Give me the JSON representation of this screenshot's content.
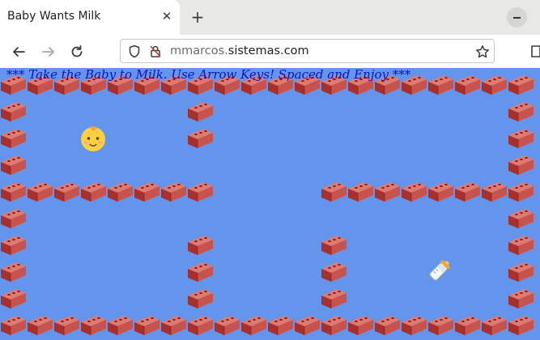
{
  "tab": {
    "title": "Baby Wants Milk",
    "close_icon": "✕",
    "new_tab_icon": "+"
  },
  "toolbar": {
    "url_prefix": "mmarcos.",
    "url_domain": "sistemas.com"
  },
  "game": {
    "banner": "*** Take the Baby to Milk. Use Arrow Keys! Spaced and Enjoy ***",
    "background": "#6495ed",
    "brick_color": "#c8534d",
    "baby_icon": "baby-face",
    "milk_icon": "baby-bottle",
    "maze_rows": [
      "XXXXXXXXXXXXXXXXXXXX",
      "X      X           X",
      "X      X           X",
      "X                  X",
      "XXXXXXXX    XXXXXXXX",
      "X                  X",
      "X      X    X      X",
      "X      X    X      X",
      "X      X    X      X",
      "XXXXXXXXXXXXXXXXXXXX"
    ],
    "baby_cell": [
      2,
      3
    ],
    "milk_cell": [
      8,
      16
    ]
  }
}
